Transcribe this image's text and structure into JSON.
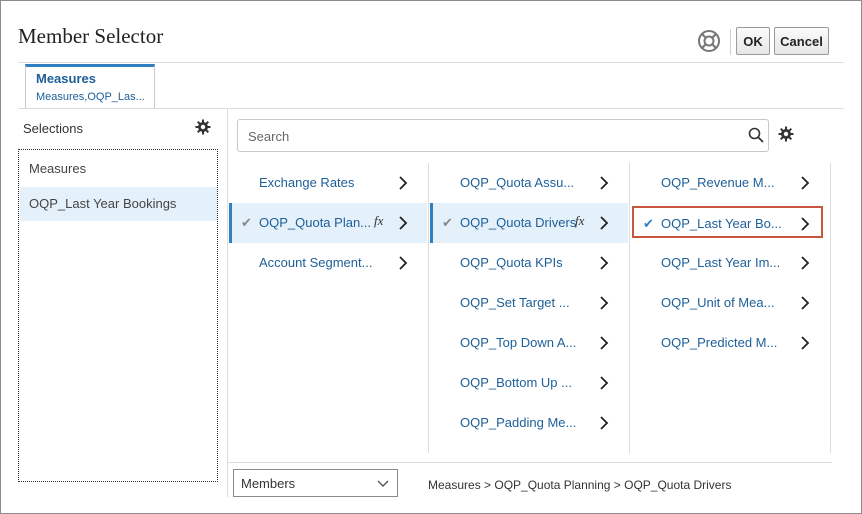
{
  "dialog": {
    "title": "Member Selector",
    "ok_label": "OK",
    "cancel_label": "Cancel"
  },
  "tab": {
    "title": "Measures",
    "subtitle": "Measures,OQP_Las..."
  },
  "selections": {
    "label": "Selections",
    "items": [
      "Measures",
      "OQP_Last Year Bookings"
    ]
  },
  "search": {
    "placeholder": "Search",
    "value": ""
  },
  "columns": [
    {
      "items": [
        {
          "label": "Exchange Rates",
          "selected": false,
          "checked": false,
          "fx": false
        },
        {
          "label": "OQP_Quota Plan...",
          "selected": true,
          "checked": true,
          "fx": true
        },
        {
          "label": "Account Segment...",
          "selected": false,
          "checked": false,
          "fx": false
        }
      ]
    },
    {
      "items": [
        {
          "label": "OQP_Quota Assu...",
          "selected": false,
          "checked": false,
          "fx": false
        },
        {
          "label": "OQP_Quota Drivers",
          "selected": true,
          "checked": true,
          "fx": true
        },
        {
          "label": "OQP_Quota KPIs",
          "selected": false,
          "checked": false,
          "fx": false
        },
        {
          "label": "OQP_Set Target ...",
          "selected": false,
          "checked": false,
          "fx": false
        },
        {
          "label": "OQP_Top Down A...",
          "selected": false,
          "checked": false,
          "fx": false
        },
        {
          "label": "OQP_Bottom Up ...",
          "selected": false,
          "checked": false,
          "fx": false
        },
        {
          "label": "OQP_Padding Me...",
          "selected": false,
          "checked": false,
          "fx": false
        }
      ]
    },
    {
      "items": [
        {
          "label": "OQP_Revenue M...",
          "selected": false,
          "checked": false,
          "fx": false
        },
        {
          "label": "OQP_Last Year Bo...",
          "selected": false,
          "checked": true,
          "fx": false,
          "highlighted": true
        },
        {
          "label": "OQP_Last Year Im...",
          "selected": false,
          "checked": false,
          "fx": false
        },
        {
          "label": "OQP_Unit of Mea...",
          "selected": false,
          "checked": false,
          "fx": false
        },
        {
          "label": "OQP_Predicted M...",
          "selected": false,
          "checked": false,
          "fx": false
        }
      ]
    }
  ],
  "fx_symbol": "fx",
  "check_symbol": "✔",
  "footer": {
    "members_select_value": "Members",
    "breadcrumb": "Measures > OQP_Quota Planning > OQP_Quota Drivers"
  },
  "colors": {
    "link": "#1e5f99",
    "selected_bg": "#e4f0fa",
    "accent": "#2f7fc1",
    "highlight_border": "#c8553d"
  }
}
